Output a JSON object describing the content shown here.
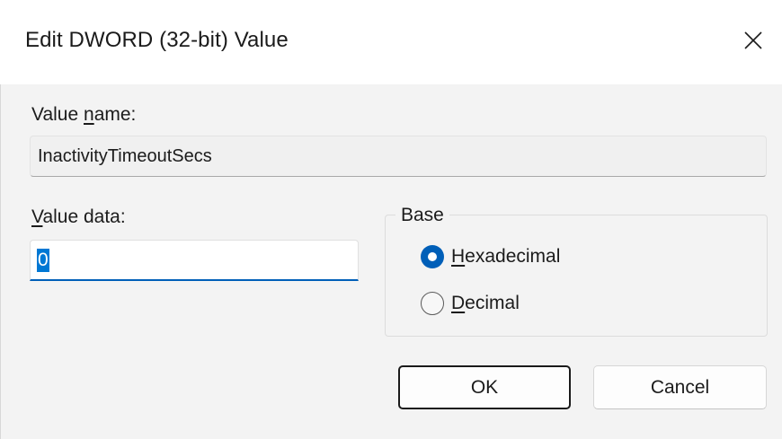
{
  "window": {
    "title": "Edit DWORD (32-bit) Value",
    "close_glyph": "×",
    "close_icon": "close-icon"
  },
  "value_name": {
    "label_prefix": "Value ",
    "label_mnemonic": "n",
    "label_suffix": "ame:",
    "value": "InactivityTimeoutSecs"
  },
  "value_data": {
    "label_mnemonic": "V",
    "label_suffix": "alue data:",
    "value": "0"
  },
  "base": {
    "legend": "Base",
    "options": [
      {
        "mnemonic": "H",
        "rest": "exadecimal",
        "selected": true
      },
      {
        "mnemonic": "D",
        "rest": "ecimal",
        "selected": false
      }
    ]
  },
  "buttons": {
    "ok": "OK",
    "cancel": "Cancel"
  },
  "colors": {
    "accent": "#005fb8",
    "selection": "#0078d4",
    "dialog_bg": "#f3f3f3",
    "titlebar_bg": "#ffffff"
  }
}
